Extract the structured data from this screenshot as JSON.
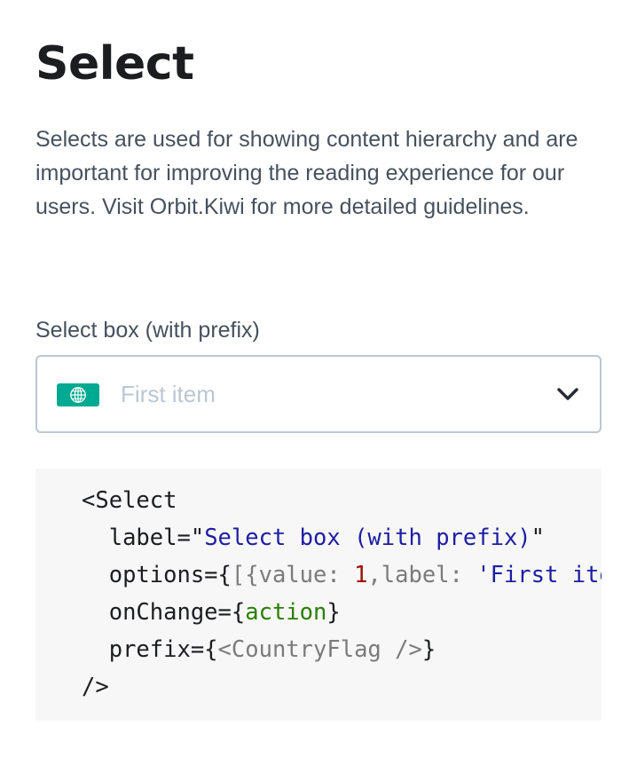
{
  "page": {
    "title": "Select",
    "intro": "Selects are used for showing content hierarchy and are important for improving the reading experience for our users. Visit Orbit.Kiwi for more detailed guidelines."
  },
  "select": {
    "label": "Select box (with prefix)",
    "placeholder": "First item",
    "prefix_icon": "globe-icon",
    "dropdown_icon": "chevron-down-icon",
    "accent_color": "#00a991"
  },
  "code": {
    "line1": "<Select",
    "attr_label": "label=",
    "q_open": "\"",
    "label_value": "Select box (with prefix)",
    "q_close": "\"",
    "attr_options": "options={",
    "options_p1": "[{value: ",
    "options_num": "1",
    "options_p2": ",label: ",
    "options_str": "'First item'",
    "options_p3": "}]",
    "options_end": "}",
    "attr_onchange": "onChange={",
    "onchange_value": "action",
    "onchange_end": "}",
    "attr_prefix": "prefix={",
    "prefix_value": "<CountryFlag />",
    "prefix_end": "}",
    "close": "/>"
  }
}
